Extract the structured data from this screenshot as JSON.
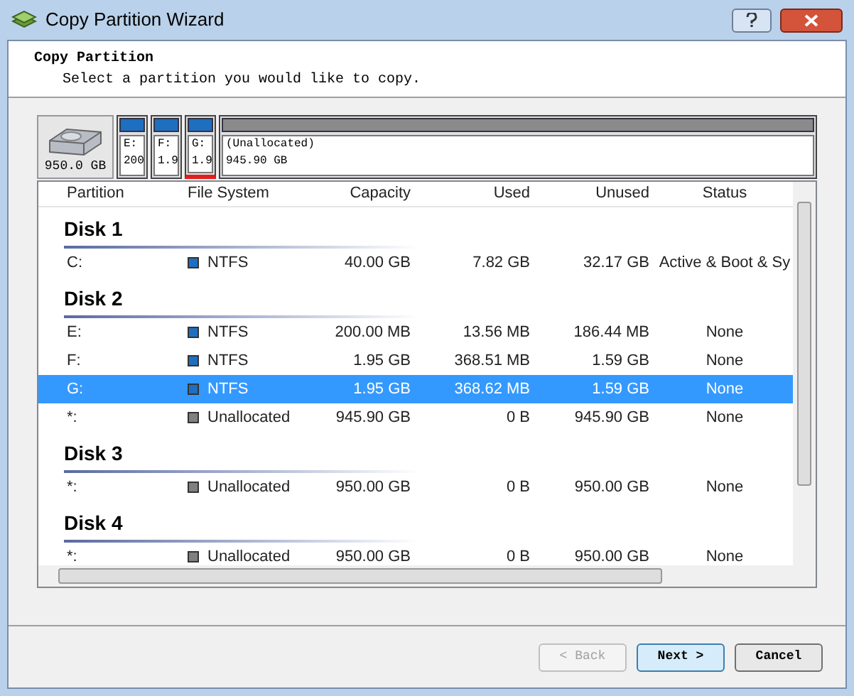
{
  "window": {
    "title": "Copy Partition Wizard"
  },
  "header": {
    "title": "Copy Partition",
    "subtitle": "Select a partition you would like to copy."
  },
  "disk_map": {
    "disk_size": "950.0 GB",
    "partitions": [
      {
        "line_1": "E:",
        "line_2": "200",
        "color": "#1e6fc0",
        "selected": false,
        "kind": "small"
      },
      {
        "line_1": "F:",
        "line_2": "1.9",
        "color": "#1e6fc0",
        "selected": false,
        "kind": "small"
      },
      {
        "line_1": "G:",
        "line_2": "1.9",
        "color": "#1e6fc0",
        "selected": true,
        "kind": "small"
      },
      {
        "line_1": "(Unallocated)",
        "line_2": "945.90 GB",
        "color": "#8a8a8a",
        "selected": false,
        "kind": "wide"
      }
    ]
  },
  "table": {
    "columns": [
      "Partition",
      "File System",
      "Capacity",
      "Used",
      "Unused",
      "Status"
    ],
    "groups": [
      {
        "disk": "Disk 1",
        "rows": [
          {
            "partition": "C:",
            "file_system": "NTFS",
            "color": "#1e6fc0",
            "capacity": "40.00 GB",
            "used": "7.82 GB",
            "unused": "32.17 GB",
            "status": "Active & Boot & Sy",
            "selected": false
          }
        ]
      },
      {
        "disk": "Disk 2",
        "rows": [
          {
            "partition": "E:",
            "file_system": "NTFS",
            "color": "#1e6fc0",
            "capacity": "200.00 MB",
            "used": "13.56 MB",
            "unused": "186.44 MB",
            "status": "None",
            "selected": false
          },
          {
            "partition": "F:",
            "file_system": "NTFS",
            "color": "#1e6fc0",
            "capacity": "1.95 GB",
            "used": "368.51 MB",
            "unused": "1.59 GB",
            "status": "None",
            "selected": false
          },
          {
            "partition": "G:",
            "file_system": "NTFS",
            "color": "#1e6fc0",
            "capacity": "1.95 GB",
            "used": "368.62 MB",
            "unused": "1.59 GB",
            "status": "None",
            "selected": true
          },
          {
            "partition": "*:",
            "file_system": "Unallocated",
            "color": "#808080",
            "capacity": "945.90 GB",
            "used": "0 B",
            "unused": "945.90 GB",
            "status": "None",
            "selected": false
          }
        ]
      },
      {
        "disk": "Disk 3",
        "rows": [
          {
            "partition": "*:",
            "file_system": "Unallocated",
            "color": "#808080",
            "capacity": "950.00 GB",
            "used": "0 B",
            "unused": "950.00 GB",
            "status": "None",
            "selected": false
          }
        ]
      },
      {
        "disk": "Disk 4",
        "rows": [
          {
            "partition": "*:",
            "file_system": "Unallocated",
            "color": "#808080",
            "capacity": "950.00 GB",
            "used": "0 B",
            "unused": "950.00 GB",
            "status": "None",
            "selected": false
          }
        ]
      }
    ]
  },
  "buttons": [
    {
      "label": "< Back",
      "disabled": true,
      "selected": false
    },
    {
      "label": "Next >",
      "disabled": false,
      "selected": true
    },
    {
      "label": "Cancel",
      "disabled": false,
      "selected": false
    }
  ]
}
